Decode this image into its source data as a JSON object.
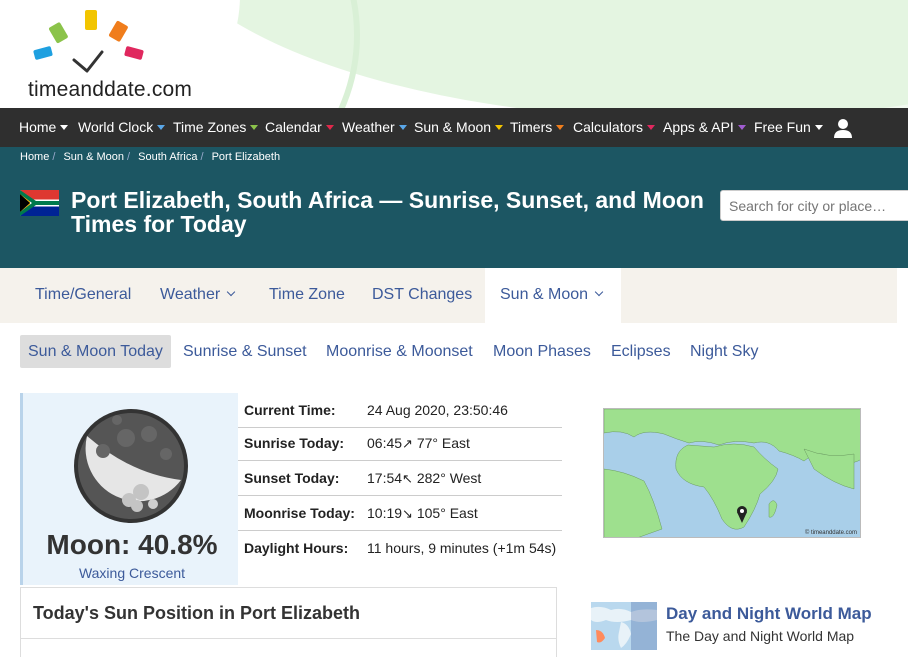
{
  "logo": {
    "text": "timeanddate.com"
  },
  "nav": {
    "items": [
      {
        "label": "Home"
      },
      {
        "label": "World Clock"
      },
      {
        "label": "Time Zones"
      },
      {
        "label": "Calendar"
      },
      {
        "label": "Weather"
      },
      {
        "label": "Sun & Moon"
      },
      {
        "label": "Timers"
      },
      {
        "label": "Calculators"
      },
      {
        "label": "Apps & API"
      },
      {
        "label": "Free Fun"
      }
    ],
    "caret_colors": [
      "#ffffff",
      "#5aa7e8",
      "#8bc34a",
      "#e0284a",
      "#5aa7e8",
      "#f2c500",
      "#f07d1c",
      "#e0285e",
      "#a05cd0",
      "#ffffff"
    ]
  },
  "breadcrumb": [
    "Home",
    "Sun & Moon",
    "South Africa",
    "Port Elizabeth"
  ],
  "title": "Port Elizabeth, South Africa — Sunrise, Sunset, and Moon Times for Today",
  "search": {
    "placeholder": "Search for city or place…"
  },
  "tabs": [
    {
      "label": "Time/General",
      "dropdown": false
    },
    {
      "label": "Weather",
      "dropdown": true
    },
    {
      "label": "Time Zone",
      "dropdown": false
    },
    {
      "label": "DST Changes",
      "dropdown": false
    },
    {
      "label": "Sun & Moon",
      "dropdown": true,
      "active": true
    }
  ],
  "subtabs": [
    "Sun & Moon Today",
    "Sunrise & Sunset",
    "Moonrise & Moonset",
    "Moon Phases",
    "Eclipses",
    "Night Sky"
  ],
  "moon": {
    "percent": "Moon: 40.8%",
    "phase": "Waxing Crescent"
  },
  "info": [
    {
      "label": "Current Time:",
      "value": "24 Aug 2020, 23:50:46"
    },
    {
      "label": "Sunrise Today:",
      "time": "06:45",
      "arrow": "↗",
      "dir": " 77° East"
    },
    {
      "label": "Sunset Today:",
      "time": "17:54",
      "arrow": "↖",
      "dir": " 282° West"
    },
    {
      "label": "Moonrise Today:",
      "time": "10:19",
      "arrow": "↘",
      "dir": " 105° East"
    },
    {
      "label": "Daylight Hours:",
      "value": "11 hours, 9 minutes (+1m 54s)"
    }
  ],
  "map": {
    "credit": "© timeanddate.com"
  },
  "sun_position": {
    "title": "Today's Sun Position in Port Elizabeth"
  },
  "day_night": {
    "title": "Day and Night World Map",
    "subtitle": "The Day and Night World Map"
  }
}
